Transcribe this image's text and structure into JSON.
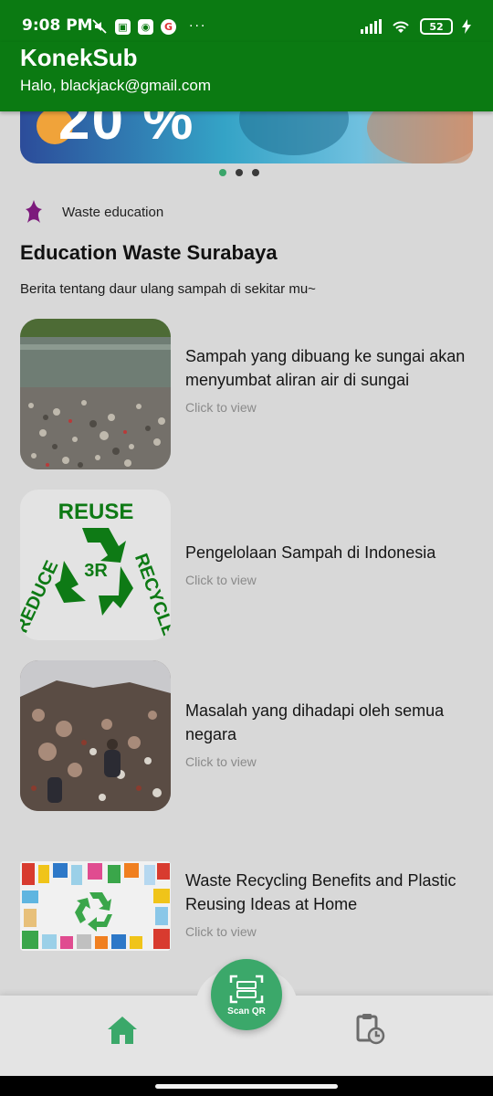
{
  "status_bar": {
    "time": "9:08 PM",
    "icons_left": [
      "mute-icon",
      "app-icon",
      "app-icon",
      "google-icon"
    ],
    "more": "···",
    "battery": "52",
    "icons_right": [
      "signal-icon",
      "wifi-icon",
      "battery-icon",
      "charging-icon"
    ]
  },
  "app": {
    "title": "KonekSub",
    "subtitle": "Halo, blackjack@gmail.com",
    "brand_color": "#0b7a12",
    "accent_color": "#3ba86a"
  },
  "banner": {
    "promo_text": "20 %",
    "carousel_count": 3,
    "carousel_active": 0
  },
  "section": {
    "tag": "Waste education",
    "tag_icon": "star-icon",
    "heading": "Education Waste Surabaya",
    "description": "Berita tentang daur ulang sampah di sekitar mu~"
  },
  "articles": [
    {
      "title": "Sampah yang dibuang ke sungai akan menyumbat aliran air di sungai",
      "cta": "Click to view",
      "image": "river-trash-image"
    },
    {
      "title": "Pengelolaan Sampah di Indonesia",
      "cta": "Click to view",
      "image": "reuse-reduce-recycle-logo"
    },
    {
      "title": "Masalah yang dihadapi oleh semua negara",
      "cta": "Click to view",
      "image": "landfill-pickers-image"
    },
    {
      "title": "Waste Recycling Benefits and Plastic Reusing Ideas at Home",
      "cta": "Click to view",
      "image": "recycling-frame-image"
    }
  ],
  "recycle_logo": {
    "top": "REUSE",
    "left": "REDUCE",
    "right": "RECYCLE",
    "center": "3R"
  },
  "bottom_nav": {
    "home_icon": "home-icon",
    "scan_label": "Scan QR",
    "scan_icon": "qr-scan-icon",
    "history_icon": "clipboard-clock-icon"
  }
}
